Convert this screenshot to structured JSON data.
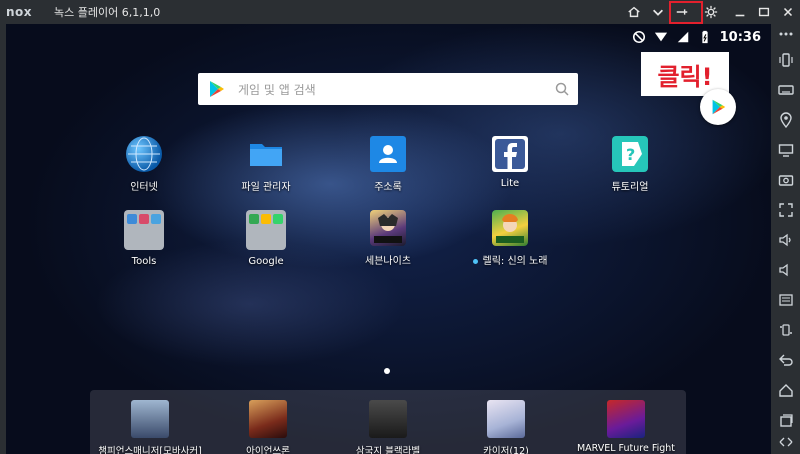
{
  "titlebar": {
    "logo": "nox",
    "title": "녹스 플레이어 6,1,1,0",
    "buttons": [
      "home-icon",
      "chevron-down-icon",
      "pin-icon",
      "gear-icon",
      "minimize-icon",
      "maximize-icon",
      "close-icon"
    ]
  },
  "status": {
    "time": "10:36"
  },
  "search": {
    "placeholder": "게임 및 앱 검색"
  },
  "annotation": {
    "text": "클릭!",
    "color": "#e2202d"
  },
  "apps": [
    {
      "label": "인터넷",
      "icon": "globe-icon"
    },
    {
      "label": "파일 관리자",
      "icon": "folder-icon"
    },
    {
      "label": "주소록",
      "icon": "contacts-icon"
    },
    {
      "label": "Lite",
      "icon": "facebook-icon"
    },
    {
      "label": "튜토리얼",
      "icon": "tutorial-icon"
    },
    {
      "label": "Tools",
      "icon": "folder-group-icon"
    },
    {
      "label": "Google",
      "icon": "folder-group-icon"
    },
    {
      "label": "세븐나이츠",
      "icon": "game-icon"
    },
    {
      "label": "렐릭: 신의 노래",
      "icon": "game-icon"
    }
  ],
  "dock": [
    {
      "label": "챔피언스매니저[모바사커]",
      "icon": "game-icon"
    },
    {
      "label": "아이언쓰론",
      "icon": "game-icon"
    },
    {
      "label": "삼국지 블랙라벨",
      "icon": "game-icon"
    },
    {
      "label": "카이저(12)",
      "icon": "game-icon"
    },
    {
      "label": "MARVEL Future Fight",
      "icon": "game-icon"
    }
  ],
  "sidebar": [
    "more-icon",
    "vibrate-icon",
    "keyboard-icon",
    "location-icon",
    "screen-icon",
    "screenshot-icon",
    "fullscreen-icon",
    "volume-up-icon",
    "volume-down-icon",
    "apk-icon",
    "shake-icon",
    "back-icon",
    "home-icon",
    "recents-icon"
  ]
}
